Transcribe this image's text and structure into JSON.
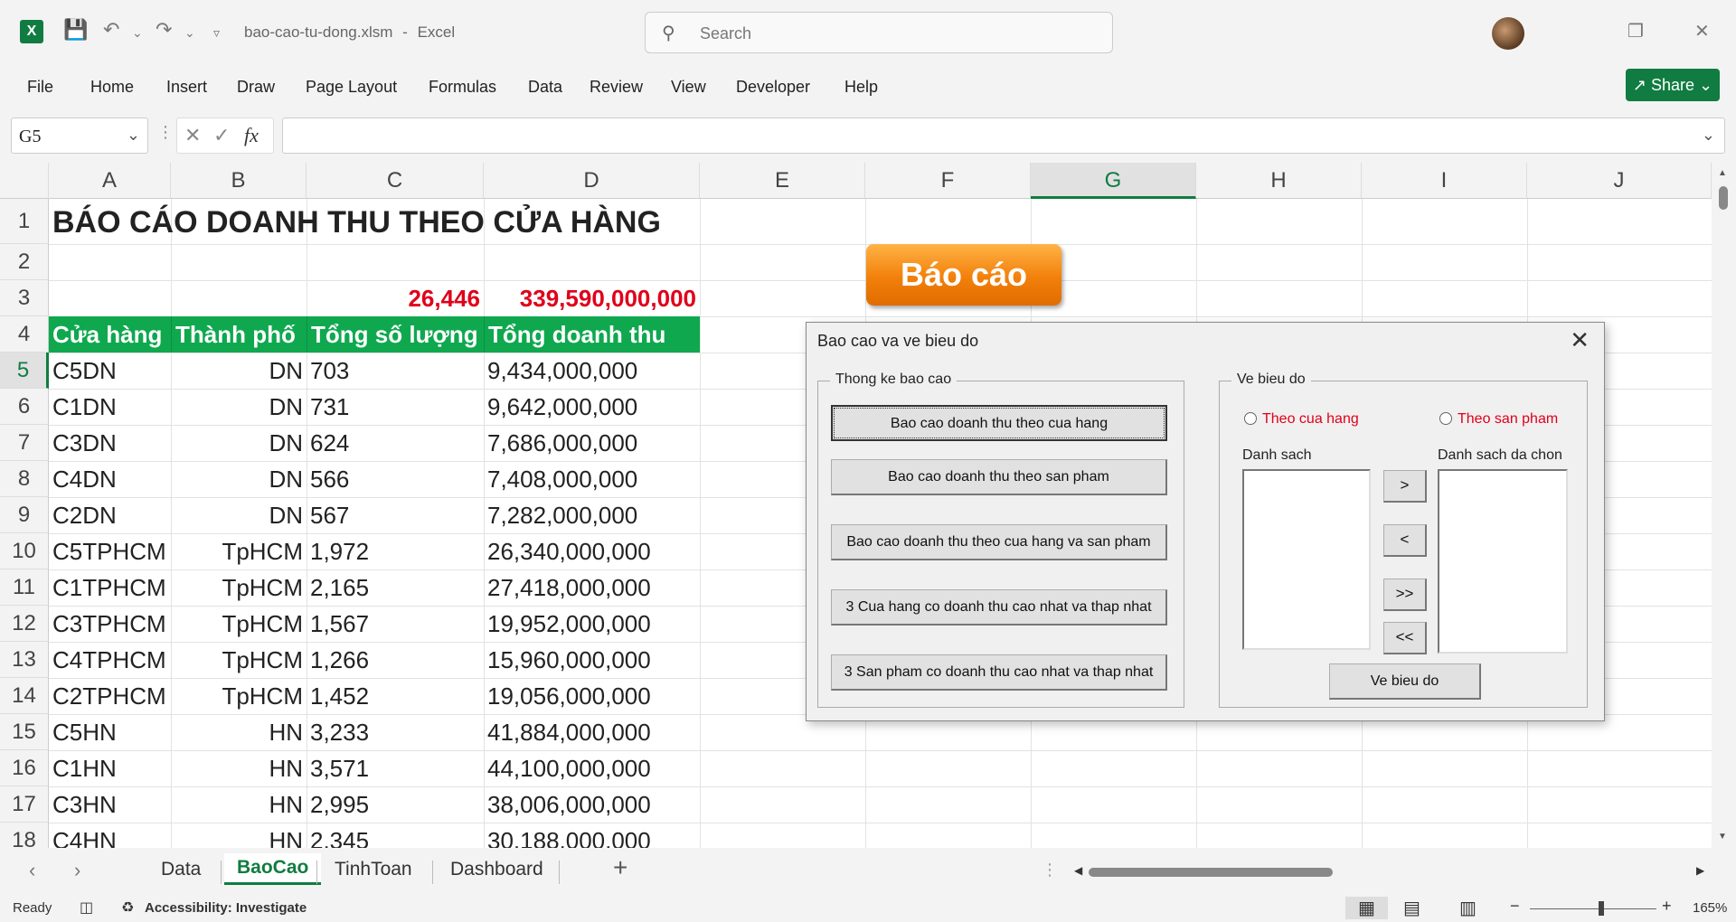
{
  "window": {
    "filename": "bao-cao-tu-dong.xlsm",
    "separator": "-",
    "app": "Excel"
  },
  "search": {
    "placeholder": "Search"
  },
  "menu": [
    "File",
    "Home",
    "Insert",
    "Draw",
    "Page Layout",
    "Formulas",
    "Data",
    "Review",
    "View",
    "Developer",
    "Help"
  ],
  "share": "Share",
  "namebox": "G5",
  "columns": [
    "A",
    "B",
    "C",
    "D",
    "E",
    "F",
    "G",
    "H",
    "I",
    "J"
  ],
  "rows": [
    "1",
    "2",
    "3",
    "4",
    "5",
    "6",
    "7",
    "8",
    "9",
    "10",
    "11",
    "12",
    "13",
    "14",
    "15",
    "16",
    "17",
    "18"
  ],
  "sheet": {
    "title": "BÁO CÁO DOANH THU THEO CỬA HÀNG",
    "total_qty": "26,446",
    "total_rev": "339,590,000,000",
    "headers": [
      "Cửa hàng",
      "Thành phố",
      "Tổng số lượng",
      "Tổng doanh thu"
    ],
    "data": [
      [
        "C5DN",
        "DN",
        "703",
        "9,434,000,000"
      ],
      [
        "C1DN",
        "DN",
        "731",
        "9,642,000,000"
      ],
      [
        "C3DN",
        "DN",
        "624",
        "7,686,000,000"
      ],
      [
        "C4DN",
        "DN",
        "566",
        "7,408,000,000"
      ],
      [
        "C2DN",
        "DN",
        "567",
        "7,282,000,000"
      ],
      [
        "C5TPHCM",
        "TpHCM",
        "1,972",
        "26,340,000,000"
      ],
      [
        "C1TPHCM",
        "TpHCM",
        "2,165",
        "27,418,000,000"
      ],
      [
        "C3TPHCM",
        "TpHCM",
        "1,567",
        "19,952,000,000"
      ],
      [
        "C4TPHCM",
        "TpHCM",
        "1,266",
        "15,960,000,000"
      ],
      [
        "C2TPHCM",
        "TpHCM",
        "1,452",
        "19,056,000,000"
      ],
      [
        "C5HN",
        "HN",
        "3,233",
        "41,884,000,000"
      ],
      [
        "C1HN",
        "HN",
        "3,571",
        "44,100,000,000"
      ],
      [
        "C3HN",
        "HN",
        "2,995",
        "38,006,000,000"
      ],
      [
        "C4HN",
        "HN",
        "2,345",
        "30,188,000,000"
      ]
    ]
  },
  "baocao_button": "Báo cáo",
  "dialog": {
    "title": "Bao cao va ve bieu do",
    "frame_left": "Thong ke bao cao",
    "buttons": [
      "Bao cao doanh thu theo cua hang",
      "Bao cao doanh thu theo san pham",
      "Bao cao doanh thu theo cua hang va san pham",
      "3 Cua hang co doanh thu cao nhat va thap nhat",
      "3 San pham co doanh thu cao nhat va thap nhat"
    ],
    "frame_right": "Ve bieu do",
    "radio_store": "Theo cua hang",
    "radio_product": "Theo san pham",
    "list_label": "Danh sach",
    "selected_label": "Danh sach da chon",
    "arrows": [
      ">",
      "<",
      ">>",
      "<<"
    ],
    "draw_button": "Ve bieu do"
  },
  "tabs": [
    "Data",
    "BaoCao",
    "TinhToan",
    "Dashboard"
  ],
  "status": {
    "ready": "Ready",
    "accessibility": "Accessibility: Investigate",
    "zoom": "165%"
  }
}
